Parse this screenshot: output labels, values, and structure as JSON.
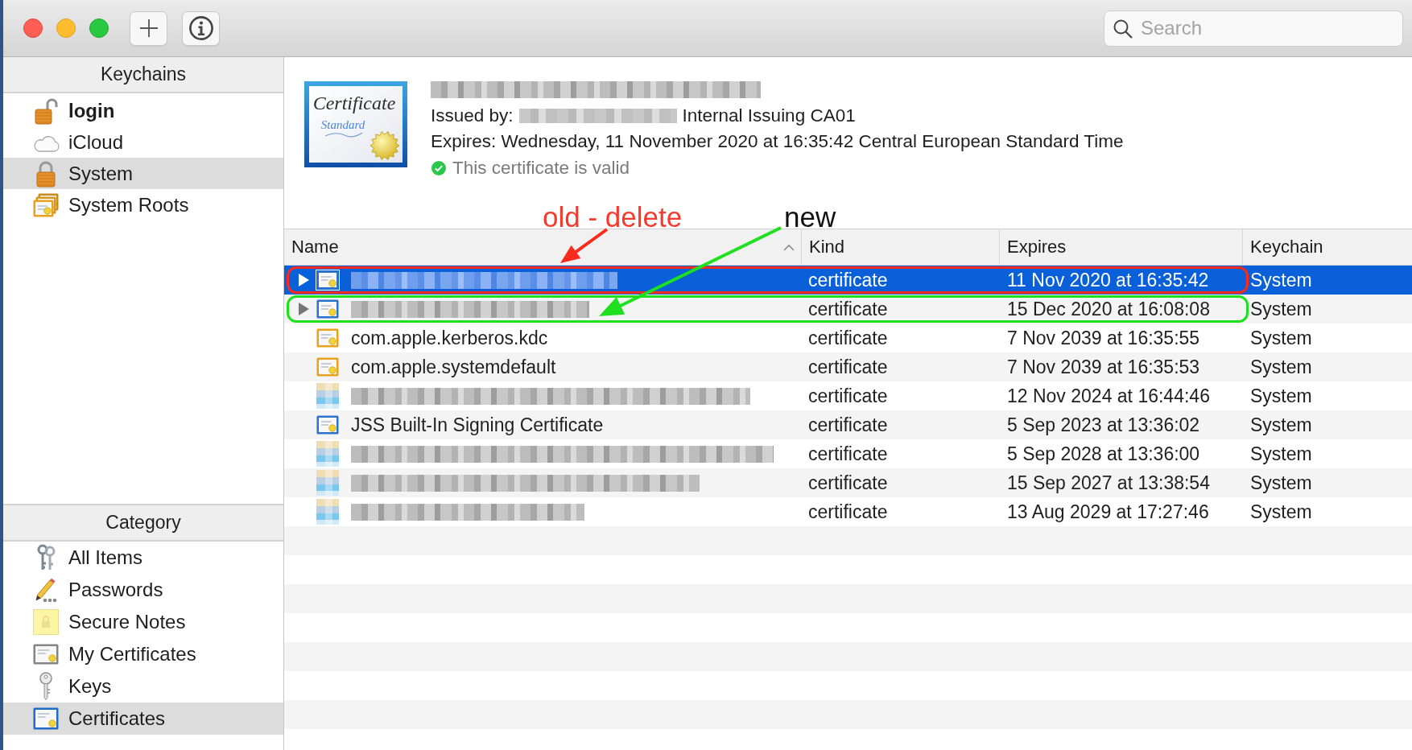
{
  "toolbar": {
    "search": {
      "placeholder": "Search"
    }
  },
  "sidebar": {
    "keychains": {
      "title": "Keychains",
      "items": [
        {
          "label": "login",
          "default": true,
          "selected": false
        },
        {
          "label": "iCloud",
          "default": false,
          "selected": false
        },
        {
          "label": "System",
          "default": false,
          "selected": true
        },
        {
          "label": "System Roots",
          "default": false,
          "selected": false
        }
      ]
    },
    "category": {
      "title": "Category",
      "items": [
        {
          "label": "All Items",
          "selected": false
        },
        {
          "label": "Passwords",
          "selected": false
        },
        {
          "label": "Secure Notes",
          "selected": false
        },
        {
          "label": "My Certificates",
          "selected": false
        },
        {
          "label": "Keys",
          "selected": false
        },
        {
          "label": "Certificates",
          "selected": true
        }
      ]
    }
  },
  "certificate": {
    "icon_caption": "Certificate",
    "icon_subcaption": "Standard",
    "name_redacted": true,
    "issued_by": {
      "label": "Issued by:",
      "name_redacted": true,
      "value": "Internal Issuing CA01"
    },
    "expires": "Expires: Wednesday, 11 November 2020 at 16:35:42 Central European Standard Time",
    "status": {
      "text": "This certificate is valid",
      "valid": true
    }
  },
  "table": {
    "columns": [
      {
        "label": "Name",
        "sorted": true
      },
      {
        "label": "Kind",
        "sorted": false
      },
      {
        "label": "Expires",
        "sorted": false
      },
      {
        "label": "Keychain",
        "sorted": false
      }
    ],
    "rows": [
      {
        "kind": "group",
        "expanded": false,
        "icon_redacted": false,
        "color": "#2c72cc",
        "name_redacted": true,
        "item_kind": "certificate",
        "expires": "11 Nov 2020 at 16:35:42",
        "keychain": "System",
        "selected": true,
        "annotation": {
          "label": {
            "text": "old - delete",
            "color": "#f5392c"
          },
          "color": "#fb2a1c"
        }
      },
      {
        "kind": "group",
        "expanded": false,
        "icon_redacted": false,
        "color": "#2c72cc",
        "name_redacted": true,
        "item_kind": "certificate",
        "expires": "15 Dec 2020 at 16:08:08",
        "keychain": "System",
        "selected": false,
        "annotation": {
          "label": {
            "text": "new",
            "color": "#111111"
          },
          "color": "#1fe01f"
        }
      },
      {
        "kind": "leaf",
        "icon_redacted": false,
        "color": "#e9a21d",
        "name_redacted": false,
        "name": "com.apple.kerberos.kdc",
        "item_kind": "certificate",
        "expires": "7 Nov 2039 at 16:35:55",
        "keychain": "System",
        "selected": false
      },
      {
        "kind": "leaf",
        "icon_redacted": false,
        "color": "#e9a21d",
        "name_redacted": false,
        "name": "com.apple.systemdefault",
        "item_kind": "certificate",
        "expires": "7 Nov 2039 at 16:35:53",
        "keychain": "System",
        "selected": false
      },
      {
        "kind": "leaf",
        "icon_redacted": true,
        "name_redacted": true,
        "item_kind": "certificate",
        "expires": "12 Nov 2024 at 16:44:46",
        "keychain": "System",
        "selected": false
      },
      {
        "kind": "leaf",
        "icon_redacted": false,
        "color": "#2c72cc",
        "name_redacted": false,
        "name": "JSS Built-In Signing Certificate",
        "item_kind": "certificate",
        "expires": "5 Sep 2023 at 13:36:02",
        "keychain": "System",
        "selected": false
      },
      {
        "kind": "leaf",
        "icon_redacted": true,
        "name_redacted": true,
        "item_kind": "certificate",
        "expires": "5 Sep 2028 at 13:36:00",
        "keychain": "System",
        "selected": false
      },
      {
        "kind": "leaf",
        "icon_redacted": true,
        "name_redacted": true,
        "item_kind": "certificate",
        "expires": "15 Sep 2027 at 13:38:54",
        "keychain": "System",
        "selected": false
      },
      {
        "kind": "leaf",
        "icon_redacted": true,
        "name_redacted": true,
        "item_kind": "certificate",
        "expires": "13 Aug 2029 at 17:27:46",
        "keychain": "System",
        "selected": false
      }
    ]
  }
}
